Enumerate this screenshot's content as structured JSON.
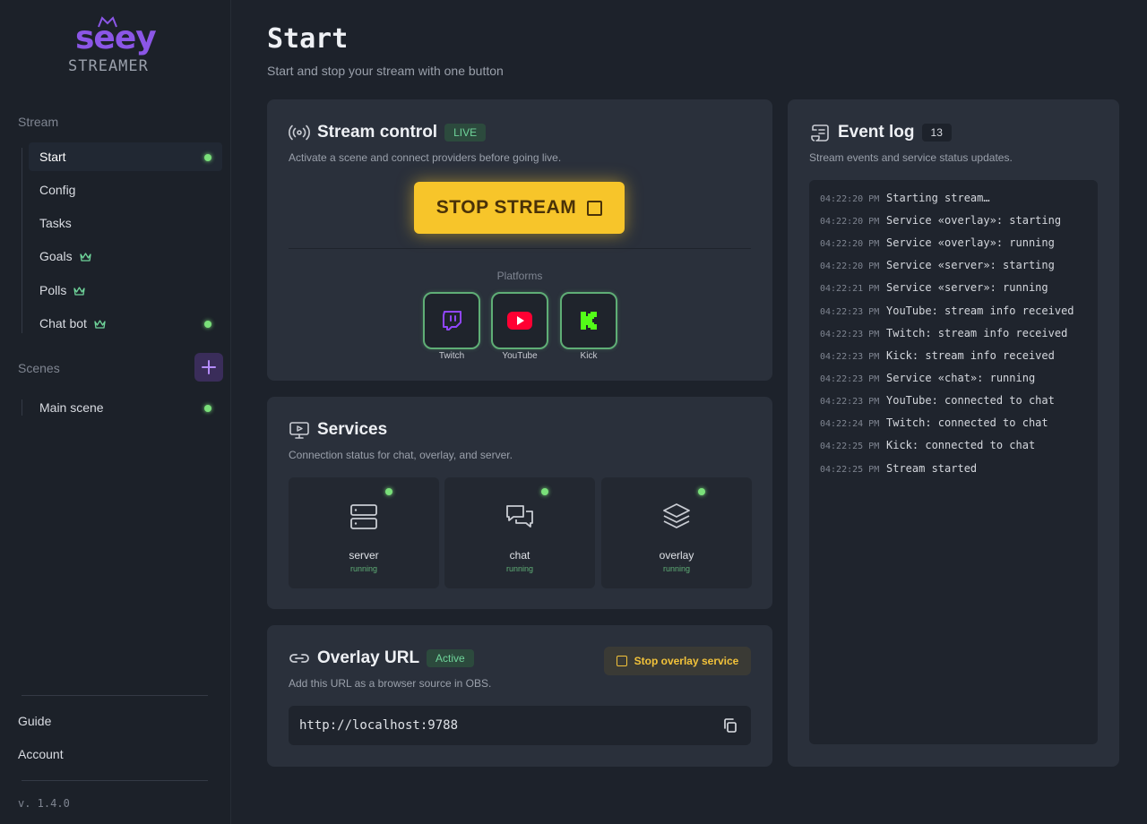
{
  "brand": {
    "name": "seey",
    "sub": "STREAMER"
  },
  "sidebar": {
    "stream_group": "Stream",
    "items": [
      {
        "label": "Start",
        "active": true,
        "dot": true
      },
      {
        "label": "Config"
      },
      {
        "label": "Tasks"
      },
      {
        "label": "Goals",
        "crown": true
      },
      {
        "label": "Polls",
        "crown": true
      },
      {
        "label": "Chat bot",
        "crown": true,
        "dot": true
      }
    ],
    "scenes_group": "Scenes",
    "scenes": [
      {
        "label": "Main scene",
        "dot": true
      }
    ],
    "guide": "Guide",
    "account": "Account",
    "version": "v. 1.4.0"
  },
  "page": {
    "title": "Start",
    "subtitle": "Start and stop your stream with one button"
  },
  "stream_control": {
    "title": "Stream control",
    "badge": "LIVE",
    "desc": "Activate a scene and connect providers before going live.",
    "stop_label": "STOP STREAM",
    "platforms_label": "Platforms",
    "platforms": [
      {
        "name": "Twitch",
        "icon": "twitch-icon",
        "color": "#9146ff"
      },
      {
        "name": "YouTube",
        "icon": "youtube-icon",
        "color": "#ff0033"
      },
      {
        "name": "Kick",
        "icon": "kick-icon",
        "color": "#53fc18"
      }
    ]
  },
  "services": {
    "title": "Services",
    "desc": "Connection status for chat, overlay, and server.",
    "items": [
      {
        "name": "server",
        "status": "running",
        "icon": "server-icon"
      },
      {
        "name": "chat",
        "status": "running",
        "icon": "chat-icon"
      },
      {
        "name": "overlay",
        "status": "running",
        "icon": "layers-icon"
      }
    ]
  },
  "overlay": {
    "title": "Overlay URL",
    "badge": "Active",
    "desc": "Add this URL as a browser source in OBS.",
    "stop_label": "Stop overlay service",
    "url": "http://localhost:9788"
  },
  "event_log": {
    "title": "Event log",
    "count": "13",
    "desc": "Stream events and service status updates.",
    "entries": [
      {
        "time": "04:22:20 PM",
        "msg": "Starting stream…"
      },
      {
        "time": "04:22:20 PM",
        "msg": "Service «overlay»: starting"
      },
      {
        "time": "04:22:20 PM",
        "msg": "Service «overlay»: running"
      },
      {
        "time": "04:22:20 PM",
        "msg": "Service «server»: starting"
      },
      {
        "time": "04:22:21 PM",
        "msg": "Service «server»: running"
      },
      {
        "time": "04:22:23 PM",
        "msg": "YouTube: stream info received"
      },
      {
        "time": "04:22:23 PM",
        "msg": "Twitch: stream info received"
      },
      {
        "time": "04:22:23 PM",
        "msg": "Kick: stream info received"
      },
      {
        "time": "04:22:23 PM",
        "msg": "Service «chat»: running"
      },
      {
        "time": "04:22:23 PM",
        "msg": "YouTube: connected to chat"
      },
      {
        "time": "04:22:24 PM",
        "msg": "Twitch: connected to chat"
      },
      {
        "time": "04:22:25 PM",
        "msg": "Kick: connected to chat"
      },
      {
        "time": "04:22:25 PM",
        "msg": "Stream started"
      }
    ]
  },
  "colors": {
    "accent_purple": "#8b56e6",
    "live_green": "#6fd49a",
    "stop_yellow": "#f7c52a",
    "status_dot": "#7ae07a"
  }
}
